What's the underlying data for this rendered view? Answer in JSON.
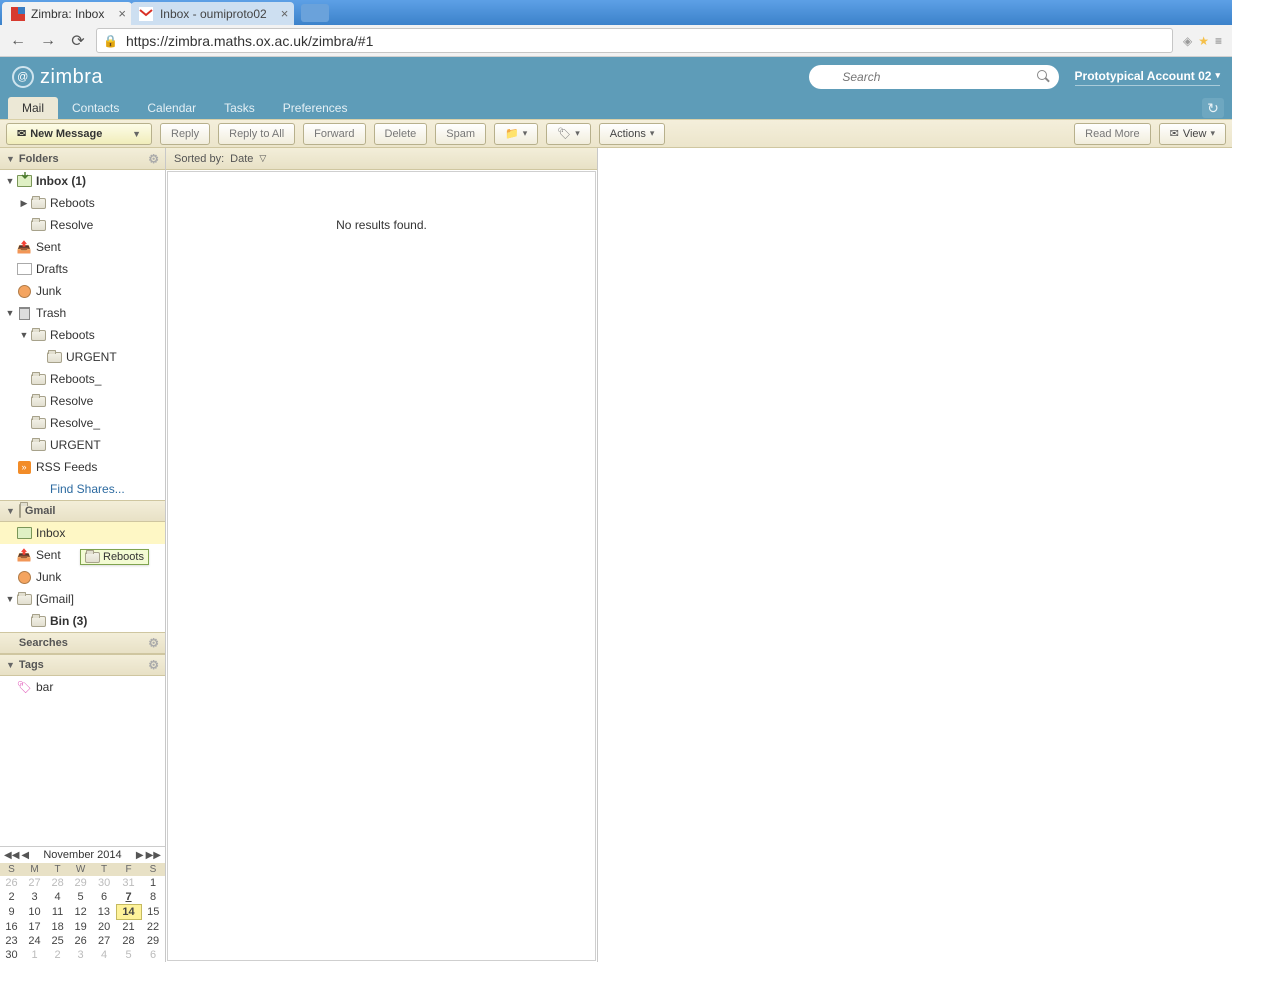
{
  "browser": {
    "tabs": [
      {
        "title": "Zimbra: Inbox",
        "active": true
      },
      {
        "title": "Inbox - oumiproto02",
        "active": false
      }
    ],
    "url": "https://zimbra.maths.ox.ac.uk/zimbra/#1"
  },
  "header": {
    "brand": "zimbra",
    "search_placeholder": "Search",
    "account": "Prototypical Account 02"
  },
  "nav": {
    "tabs": [
      "Mail",
      "Contacts",
      "Calendar",
      "Tasks",
      "Preferences"
    ],
    "active": "Mail"
  },
  "toolbar": {
    "new_message": "New Message",
    "reply": "Reply",
    "reply_all": "Reply to All",
    "forward": "Forward",
    "delete": "Delete",
    "spam": "Spam",
    "actions": "Actions",
    "read_more": "Read More",
    "view": "View"
  },
  "sidebar": {
    "folders_hdr": "Folders",
    "gmail_hdr": "Gmail",
    "searches_hdr": "Searches",
    "tags_hdr": "Tags",
    "items": {
      "inbox": "Inbox (1)",
      "reboots": "Reboots",
      "resolve": "Resolve",
      "sent": "Sent",
      "drafts": "Drafts",
      "junk": "Junk",
      "trash": "Trash",
      "t_reboots": "Reboots",
      "t_urgent": "URGENT",
      "t_reboots_": "Reboots_",
      "t_resolve": "Resolve",
      "t_resolve_": "Resolve_",
      "t_urgent2": "URGENT",
      "rss": "RSS Feeds",
      "find_shares": "Find Shares...",
      "g_inbox": "Inbox",
      "g_sent": "Sent",
      "g_junk": "Junk",
      "g_gmail": "[Gmail]",
      "g_bin": "Bin (3)",
      "tag_bar": "bar"
    }
  },
  "drag": {
    "label": "Reboots"
  },
  "list": {
    "sorted_by": "Sorted by:",
    "sort_field": "Date",
    "empty": "No results found."
  },
  "calendar": {
    "title": "November 2014",
    "dow": [
      "S",
      "M",
      "T",
      "W",
      "T",
      "F",
      "S"
    ],
    "weeks": [
      [
        {
          "d": "26",
          "off": true
        },
        {
          "d": "27",
          "off": true
        },
        {
          "d": "28",
          "off": true
        },
        {
          "d": "29",
          "off": true
        },
        {
          "d": "30",
          "off": true
        },
        {
          "d": "31",
          "off": true
        },
        {
          "d": "1"
        }
      ],
      [
        {
          "d": "2"
        },
        {
          "d": "3"
        },
        {
          "d": "4"
        },
        {
          "d": "5"
        },
        {
          "d": "6"
        },
        {
          "d": "7",
          "bu": true
        },
        {
          "d": "8"
        }
      ],
      [
        {
          "d": "9"
        },
        {
          "d": "10"
        },
        {
          "d": "11"
        },
        {
          "d": "12"
        },
        {
          "d": "13"
        },
        {
          "d": "14",
          "today": true
        },
        {
          "d": "15"
        }
      ],
      [
        {
          "d": "16"
        },
        {
          "d": "17"
        },
        {
          "d": "18"
        },
        {
          "d": "19"
        },
        {
          "d": "20"
        },
        {
          "d": "21"
        },
        {
          "d": "22"
        }
      ],
      [
        {
          "d": "23"
        },
        {
          "d": "24"
        },
        {
          "d": "25"
        },
        {
          "d": "26"
        },
        {
          "d": "27"
        },
        {
          "d": "28"
        },
        {
          "d": "29"
        }
      ],
      [
        {
          "d": "30"
        },
        {
          "d": "1",
          "off": true
        },
        {
          "d": "2",
          "off": true
        },
        {
          "d": "3",
          "off": true
        },
        {
          "d": "4",
          "off": true
        },
        {
          "d": "5",
          "off": true
        },
        {
          "d": "6",
          "off": true
        }
      ]
    ]
  }
}
